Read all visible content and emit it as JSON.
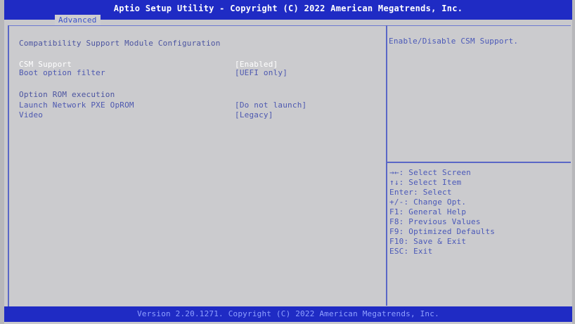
{
  "header": {
    "title": "Aptio Setup Utility - Copyright (C) 2022 American Megatrends, Inc.",
    "active_tab": "Advanced"
  },
  "main": {
    "section_title": "Compatibility Support Module Configuration",
    "settings": [
      {
        "label": "CSM Support",
        "value": "[Enabled]",
        "selected": true
      },
      {
        "label": "Boot option filter",
        "value": "[UEFI only]"
      }
    ],
    "subsection_title": "Option ROM execution",
    "option_rom_settings": [
      {
        "label": "Launch Network PXE OpROM",
        "value": "[Do not launch]"
      },
      {
        "label": "Video",
        "value": "[Legacy]"
      }
    ]
  },
  "help": {
    "description": "Enable/Disable CSM Support.",
    "keys": [
      {
        "icon": "left-right-arrows-icon",
        "key": "→←",
        "action": ": Select Screen"
      },
      {
        "icon": "up-down-arrows-icon",
        "key": "↑↓",
        "action": ": Select Item"
      },
      {
        "key": "Enter",
        "action": ": Select"
      },
      {
        "key": "+/-",
        "action": ": Change Opt."
      },
      {
        "key": "F1",
        "action": ": General Help"
      },
      {
        "key": "F8",
        "action": ": Previous Values"
      },
      {
        "key": "F9",
        "action": ": Optimized Defaults"
      },
      {
        "key": "F10",
        "action": ": Save & Exit"
      },
      {
        "key": "ESC",
        "action": ": Exit"
      }
    ]
  },
  "footer": {
    "text": "Version 2.20.1271. Copyright (C) 2022 American Megatrends, Inc."
  },
  "colors": {
    "title_bar": "#1f2bc4",
    "panel_background": "#cbcbce",
    "text_blue": "#4d58b0",
    "selected_text": "#ffffff"
  }
}
